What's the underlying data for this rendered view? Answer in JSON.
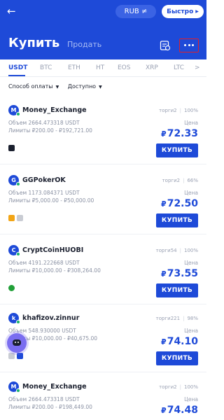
{
  "header": {
    "back_icon": "arrow-left-icon",
    "currency_label": "RUB ≠",
    "quick_label": "Быстро",
    "buy_title": "Купить",
    "sell_title": "Продать",
    "orders_icon": "orders-icon",
    "more_icon": "more-dots-icon",
    "colors": {
      "primary": "#1e4ad8",
      "highlight": "#e0202a"
    }
  },
  "tabs": [
    {
      "label": "USDT",
      "active": true
    },
    {
      "label": "BTC"
    },
    {
      "label": "ETH"
    },
    {
      "label": "HT"
    },
    {
      "label": "EOS"
    },
    {
      "label": "XRP"
    },
    {
      "label": "LTC"
    },
    {
      "label": ">"
    }
  ],
  "filters": {
    "payment_method": "Способ оплаты",
    "available": "Доступно"
  },
  "listings": [
    {
      "avatar_letter": "M",
      "merchant": "Money_Exchange",
      "trades": "торги2",
      "completion": "100%",
      "volume": "Объем 2664.473318 USDT",
      "limits": "Лимиты ₽200.00 - ₽192,721.00",
      "price_label": "Цена",
      "currency_symbol": "₽",
      "price": "72.33",
      "buy_label": "КУПИТЬ",
      "payment_icons": [
        "#1a1f2e"
      ]
    },
    {
      "avatar_letter": "G",
      "merchant": "GGPokerOK",
      "trades": "торги2",
      "completion": "66%",
      "volume": "Объем 1173.084371 USDT",
      "limits": "Лимиты ₽5,000.00 - ₽50,000.00",
      "price_label": "Цена",
      "currency_symbol": "₽",
      "price": "72.50",
      "buy_label": "КУПИТЬ",
      "payment_icons": [
        "#f2a516",
        "#c9ccd3"
      ]
    },
    {
      "avatar_letter": "C",
      "merchant": "CryptCoinHUOBI",
      "trades": "торги54",
      "completion": "100%",
      "volume": "Объем 4191.222668 USDT",
      "limits": "Лимиты ₽10,000.00 - ₽308,264.00",
      "price_label": "Цена",
      "currency_symbol": "₽",
      "price": "73.55",
      "buy_label": "КУПИТЬ",
      "payment_icons": [
        "#21a038"
      ]
    },
    {
      "avatar_letter": "k",
      "merchant": "khafizov.zinnur",
      "trades": "торги221",
      "completion": "98%",
      "volume": "Объем 548.930000 USDT",
      "limits": "Лимиты ₽10,000.00 - ₽40,675.00",
      "price_label": "Цена",
      "currency_symbol": "₽",
      "price": "74.10",
      "buy_label": "КУПИТЬ",
      "payment_icons": [
        "#c9ccd3",
        "#1e4ad8"
      ]
    },
    {
      "avatar_letter": "M",
      "merchant": "Money_Exchange",
      "trades": "торги2",
      "completion": "100%",
      "volume": "Объем 2664.473318 USDT",
      "limits": "Лимиты ₽200.00 - ₽198,449.00",
      "price_label": "Цена",
      "currency_symbol": "₽",
      "price": "74.48",
      "buy_label": "",
      "payment_icons": []
    }
  ]
}
